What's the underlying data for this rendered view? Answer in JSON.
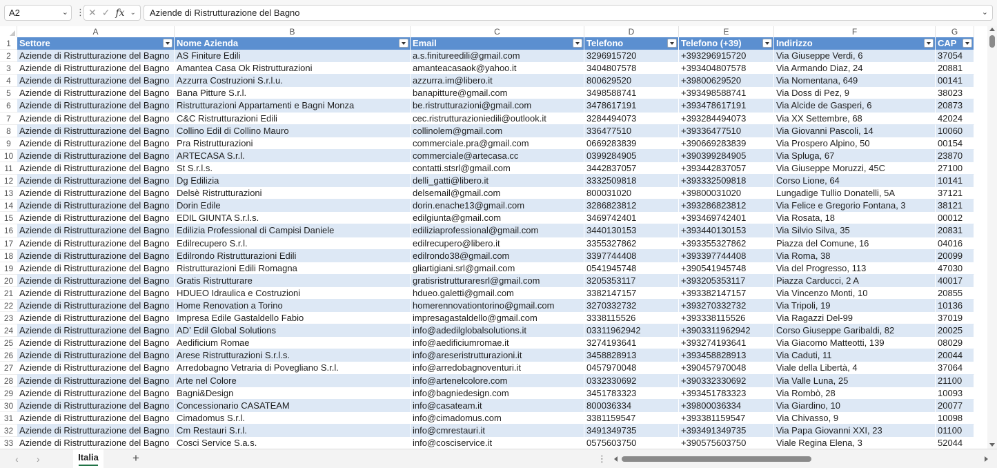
{
  "name_box": "A2",
  "formula_bar": {
    "fx_label": "fx",
    "value": "Aziende di Ristrutturazione del Bagno"
  },
  "columns": [
    "A",
    "B",
    "C",
    "D",
    "E",
    "F",
    "G"
  ],
  "headers": [
    "Settore",
    "Nome Azienda",
    "Email",
    "Telefono",
    "Telefono (+39)",
    "Indirizzo",
    "CAP"
  ],
  "header_row_number": "1",
  "rows": [
    {
      "n": "2",
      "c": [
        "Aziende di Ristrutturazione del Bagno",
        "AS Finiture Edili",
        "a.s.finitureedili@gmail.com",
        "3296915720",
        "+393296915720",
        "Via Giuseppe Verdi, 6",
        "37054"
      ]
    },
    {
      "n": "3",
      "c": [
        "Aziende di Ristrutturazione del Bagno",
        "Amantea Casa Ok Ristrutturazioni",
        "amanteacasaok@yahoo.it",
        "3404807578",
        "+393404807578",
        "Via Armando Diaz, 24",
        "20881"
      ]
    },
    {
      "n": "4",
      "c": [
        "Aziende di Ristrutturazione del Bagno",
        "Azzurra Costruzioni S.r.l.u.",
        "azzurra.im@libero.it",
        "800629520",
        "+39800629520",
        "Via Nomentana, 649",
        "00141"
      ]
    },
    {
      "n": "5",
      "c": [
        "Aziende di Ristrutturazione del Bagno",
        "Bana Pitture S.r.l.",
        "banapitture@gmail.com",
        "3498588741",
        "+393498588741",
        "Via Doss di Pez, 9",
        "38023"
      ]
    },
    {
      "n": "6",
      "c": [
        "Aziende di Ristrutturazione del Bagno",
        "Ristrutturazioni Appartamenti e Bagni Monza",
        "be.ristrutturazioni@gmail.com",
        "3478617191",
        "+393478617191",
        "Via Alcide de Gasperi, 6",
        "20873"
      ]
    },
    {
      "n": "7",
      "c": [
        "Aziende di Ristrutturazione del Bagno",
        "C&C Ristrutturazioni Edili",
        "cec.ristrutturazioniedili@outlook.it",
        "3284494073",
        "+393284494073",
        "Via XX Settembre, 68",
        "42024"
      ]
    },
    {
      "n": "8",
      "c": [
        "Aziende di Ristrutturazione del Bagno",
        "Collino Edil di Collino Mauro",
        "collinolem@gmail.com",
        "336477510",
        "+39336477510",
        "Via Giovanni Pascoli, 14",
        "10060"
      ]
    },
    {
      "n": "9",
      "c": [
        "Aziende di Ristrutturazione del Bagno",
        "Pra Ristrutturazioni",
        "commerciale.pra@gmail.com",
        "0669283839",
        "+390669283839",
        "Via Prospero Alpino, 50",
        "00154"
      ]
    },
    {
      "n": "10",
      "c": [
        "Aziende di Ristrutturazione del Bagno",
        "ARTECASA S.r.l.",
        "commerciale@artecasa.cc",
        "0399284905",
        "+390399284905",
        "Via Spluga, 67",
        "23870"
      ]
    },
    {
      "n": "11",
      "c": [
        "Aziende di Ristrutturazione del Bagno",
        "St S.r.l.s.",
        "contatti.stsrl@gmail.com",
        "3442837057",
        "+393442837057",
        "Via Giuseppe Moruzzi, 45C",
        "27100"
      ]
    },
    {
      "n": "12",
      "c": [
        "Aziende di Ristrutturazione del Bagno",
        "Dg Edilizia",
        "delli_gatti@libero.it",
        "3332509818",
        "+393332509818",
        "Corso Lione, 64",
        "10141"
      ]
    },
    {
      "n": "13",
      "c": [
        "Aziende di Ristrutturazione del Bagno",
        "Delsè Ristrutturazioni",
        "delsemail@gmail.com",
        "800031020",
        "+39800031020",
        "Lungadige Tullio Donatelli, 5A",
        "37121"
      ]
    },
    {
      "n": "14",
      "c": [
        "Aziende di Ristrutturazione del Bagno",
        "Dorin Edile",
        "dorin.enache13@gmail.com",
        "3286823812",
        "+393286823812",
        "Via Felice e Gregorio Fontana, 3",
        "38121"
      ]
    },
    {
      "n": "15",
      "c": [
        "Aziende di Ristrutturazione del Bagno",
        "EDIL GIUNTA S.r.l.s.",
        "edilgiunta@gmail.com",
        "3469742401",
        "+393469742401",
        "Via Rosata, 18",
        "00012"
      ]
    },
    {
      "n": "16",
      "c": [
        "Aziende di Ristrutturazione del Bagno",
        "Edilizia Professional di Campisi Daniele",
        "ediliziaprofessional@gmail.com",
        "3440130153",
        "+393440130153",
        "Via Silvio Silva, 35",
        "20831"
      ]
    },
    {
      "n": "17",
      "c": [
        "Aziende di Ristrutturazione del Bagno",
        "Edilrecupero S.r.l.",
        "edilrecupero@libero.it",
        "3355327862",
        "+393355327862",
        "Piazza del Comune, 16",
        "04016"
      ]
    },
    {
      "n": "18",
      "c": [
        "Aziende di Ristrutturazione del Bagno",
        "Edilrondo Ristrutturazioni Edili",
        "edilrondo38@gmail.com",
        "3397744408",
        "+393397744408",
        "Via Roma, 38",
        "20099"
      ]
    },
    {
      "n": "19",
      "c": [
        "Aziende di Ristrutturazione del Bagno",
        "Ristrutturazioni Edili Romagna",
        "gliartigiani.srl@gmail.com",
        "0541945748",
        "+390541945748",
        "Via del Progresso, 113",
        "47030"
      ]
    },
    {
      "n": "20",
      "c": [
        "Aziende di Ristrutturazione del Bagno",
        "Gratis Ristrutturare",
        "gratisristrutturaresrl@gmail.com",
        "3205353117",
        "+393205353117",
        "Piazza Carducci, 2 A",
        "40017"
      ]
    },
    {
      "n": "21",
      "c": [
        "Aziende di Ristrutturazione del Bagno",
        "HDUEO Idraulica e Costruzioni",
        "hdueo.galetti@gmail.com",
        "3382147157",
        "+393382147157",
        "Via Vincenzo Monti, 10",
        "20855"
      ]
    },
    {
      "n": "22",
      "c": [
        "Aziende di Ristrutturazione del Bagno",
        "Home Renovation a Torino",
        "homerennovationtorino@gmail.com",
        "3270332732",
        "+393270332732",
        "Via Tripoli, 19",
        "10136"
      ]
    },
    {
      "n": "23",
      "c": [
        "Aziende di Ristrutturazione del Bagno",
        "Impresa Edile Gastaldello Fabio",
        "impresagastaldello@gmail.com",
        "3338115526",
        "+393338115526",
        "Via Ragazzi Del-99",
        "37019"
      ]
    },
    {
      "n": "24",
      "c": [
        "Aziende di Ristrutturazione del Bagno",
        "AD’ Edil Global Solutions",
        "info@adedilglobalsolutions.it",
        "03311962942",
        "+3903311962942",
        "Corso Giuseppe Garibaldi, 82",
        "20025"
      ]
    },
    {
      "n": "25",
      "c": [
        "Aziende di Ristrutturazione del Bagno",
        "Aedificium Romae",
        "info@aedificiumromae.it",
        "3274193641",
        "+393274193641",
        "Via Giacomo Matteotti, 139",
        "08029"
      ]
    },
    {
      "n": "26",
      "c": [
        "Aziende di Ristrutturazione del Bagno",
        "Arese Ristrutturazioni S.r.l.s.",
        "info@areseristrutturazioni.it",
        "3458828913",
        "+393458828913",
        "Via Caduti, 11",
        "20044"
      ]
    },
    {
      "n": "27",
      "c": [
        "Aziende di Ristrutturazione del Bagno",
        "Arredobagno Vetraria di Povegliano S.r.l.",
        "info@arredobagnoventuri.it",
        "0457970048",
        "+390457970048",
        "Viale della Libertà, 4",
        "37064"
      ]
    },
    {
      "n": "28",
      "c": [
        "Aziende di Ristrutturazione del Bagno",
        "Arte nel Colore",
        "info@artenelcolore.com",
        "0332330692",
        "+390332330692",
        "Via Valle Luna, 25",
        "21100"
      ]
    },
    {
      "n": "29",
      "c": [
        "Aziende di Ristrutturazione del Bagno",
        "Bagni&Design",
        "info@bagniedesign.com",
        "3451783323",
        "+393451783323",
        "Via Rombò, 28",
        "10093"
      ]
    },
    {
      "n": "30",
      "c": [
        "Aziende di Ristrutturazione del Bagno",
        "Concessionario CASATEAM",
        "info@casateam.it",
        "800036334",
        "+39800036334",
        "Via Giardino, 10",
        "20077"
      ]
    },
    {
      "n": "31",
      "c": [
        "Aziende di Ristrutturazione del Bagno",
        "Cimadomus S.r.l.",
        "info@cimadomus.com",
        "3381159547",
        "+393381159547",
        "Via Chivasso, 9",
        "10098"
      ]
    },
    {
      "n": "32",
      "c": [
        "Aziende di Ristrutturazione del Bagno",
        "Cm Restauri S.r.l.",
        "info@cmrestauri.it",
        "3491349735",
        "+393491349735",
        "Via Papa Giovanni XXI, 23",
        "01100"
      ]
    },
    {
      "n": "33",
      "c": [
        "Aziende di Ristrutturazione del Bagno",
        "Cosci Service S.a.s.",
        "info@cosciservice.it",
        "0575603750",
        "+390575603750",
        "Viale Regina Elena, 3",
        "52044"
      ]
    }
  ],
  "sheet_tabs": [
    "Italia"
  ],
  "colors": {
    "header_fill": "#5b8fd0",
    "band_fill": "#dde8f5",
    "tab_accent": "#217346"
  },
  "icons": [
    "chevron-down-icon",
    "cancel-icon",
    "check-icon",
    "fx-icon",
    "add-sheet-icon",
    "scroll-arrow-icon"
  ]
}
